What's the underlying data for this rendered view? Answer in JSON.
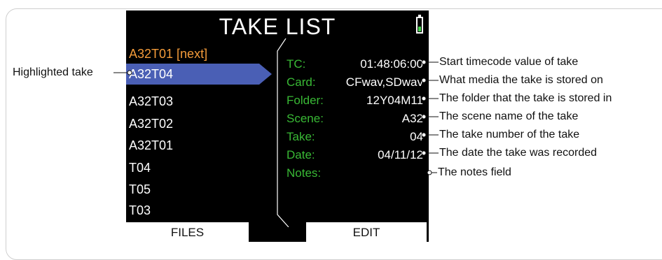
{
  "screen": {
    "title": "TAKE LIST",
    "battery_icon": "battery-icon",
    "battery_color": "#44d24a",
    "next_take": "A32T01 [next]",
    "highlighted_take": "A32T04",
    "takes": [
      "A32T03",
      "A32T02",
      "A32T01",
      "T04",
      "T05",
      "T03"
    ],
    "info": [
      {
        "label": "TC:",
        "value": "01:48:06:00"
      },
      {
        "label": "Card:",
        "value": "CFwav,SDwav"
      },
      {
        "label": "Folder:",
        "value": "12Y04M11"
      },
      {
        "label": "Scene:",
        "value": "A32"
      },
      {
        "label": "Take:",
        "value": "04"
      },
      {
        "label": "Date:",
        "value": "04/11/12"
      },
      {
        "label": "Notes:",
        "value": ""
      }
    ],
    "softkeys": {
      "files": "FILES",
      "edit": "EDIT"
    },
    "colors": {
      "label_green": "#39b935",
      "next_orange": "#f39b3a",
      "highlight_blue": "#4a5fb5"
    }
  },
  "annotations": {
    "highlighted_take": "Highlighted take",
    "callouts": [
      "Start timecode value of take",
      "What media the take is stored on",
      "The folder that the take is stored in",
      "The scene name of the take",
      "The take number of the take",
      "The date the take was recorded",
      "The notes field"
    ]
  }
}
